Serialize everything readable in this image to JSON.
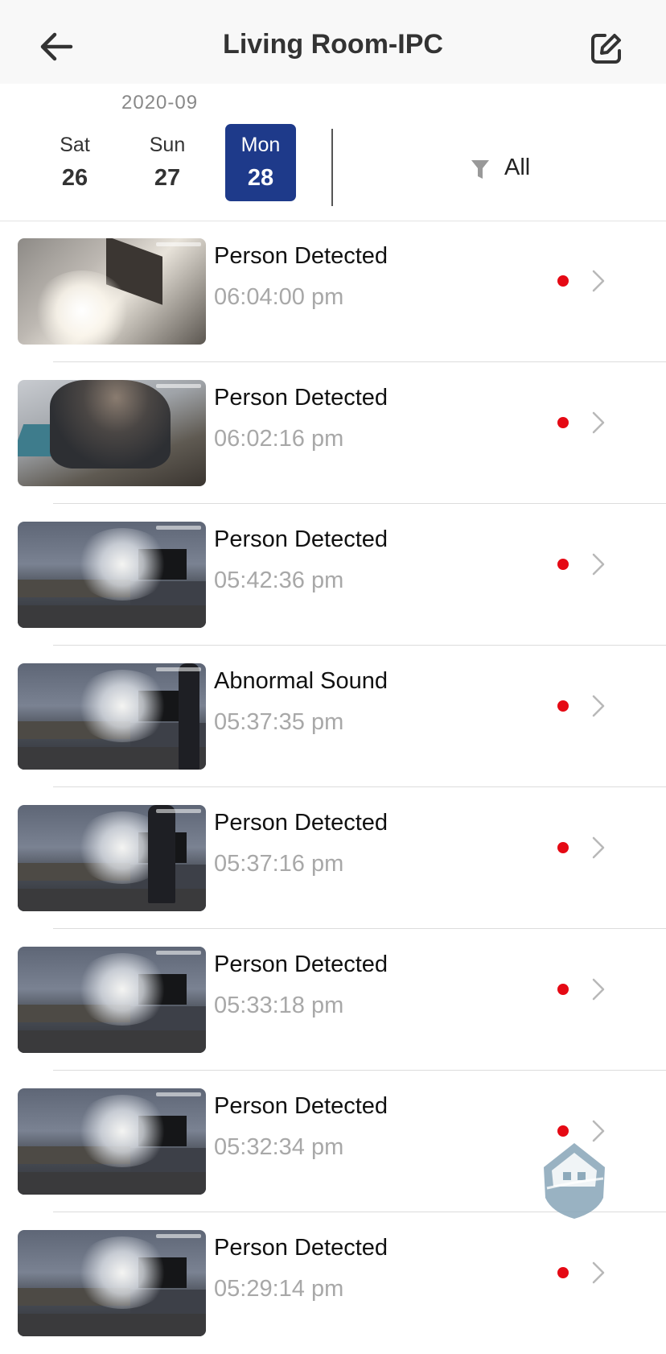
{
  "header": {
    "title": "Living Room-IPC",
    "back_icon": "arrow-left-icon",
    "edit_icon": "edit-square-icon"
  },
  "date_selector": {
    "month": "2020-09",
    "days": [
      {
        "dow": "Sat",
        "num": "26",
        "selected": false
      },
      {
        "dow": "Sun",
        "num": "27",
        "selected": false
      },
      {
        "dow": "Mon",
        "num": "28",
        "selected": true
      }
    ],
    "selected_color": "#1e3a8a"
  },
  "filter": {
    "icon": "funnel-icon",
    "label": "All"
  },
  "events": [
    {
      "title": "Person Detected",
      "time": "06:04:00 pm",
      "unread": true
    },
    {
      "title": "Person Detected",
      "time": "06:02:16 pm",
      "unread": true
    },
    {
      "title": "Person Detected",
      "time": "05:42:36 pm",
      "unread": true
    },
    {
      "title": "Abnormal Sound",
      "time": "05:37:35 pm",
      "unread": true
    },
    {
      "title": "Person Detected",
      "time": "05:37:16 pm",
      "unread": true
    },
    {
      "title": "Person Detected",
      "time": "05:33:18 pm",
      "unread": true
    },
    {
      "title": "Person Detected",
      "time": "05:32:34 pm",
      "unread": true
    },
    {
      "title": "Person Detected",
      "time": "05:29:14 pm",
      "unread": true
    }
  ],
  "colors": {
    "unread_dot": "#e50914",
    "time_text": "#a8a8a8"
  }
}
